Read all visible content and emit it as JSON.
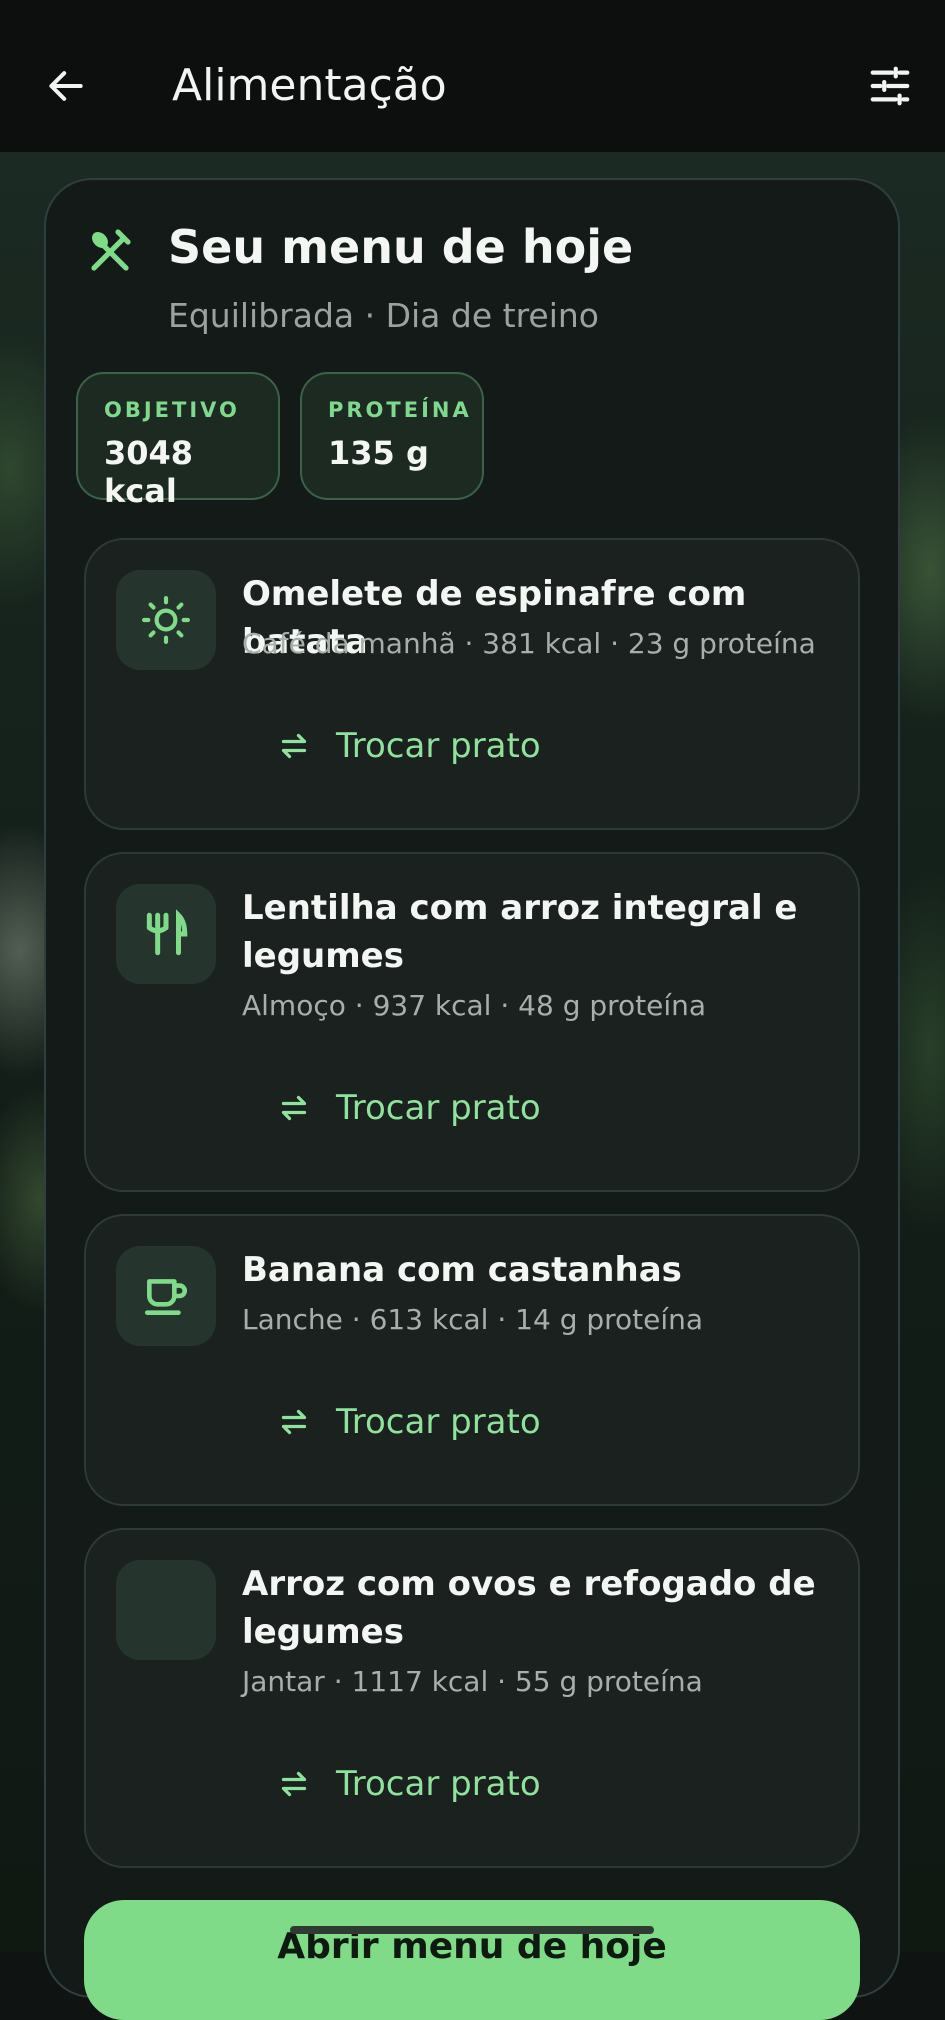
{
  "header": {
    "title": "Alimentação",
    "back_icon": "arrow-left-icon",
    "filter_icon": "sliders-icon"
  },
  "menu": {
    "title": "Seu menu de hoje",
    "subtitle": "Equilibrada · Dia de treino",
    "icon": "utensils-crossed-icon",
    "stats": [
      {
        "label": "OBJETIVO",
        "value": "3048 kcal"
      },
      {
        "label": "PROTEÍNA",
        "value": "135 g"
      }
    ],
    "meals": [
      {
        "name": "Omelete de espinafre com batata",
        "info": "Café da manhã · 381 kcal · 23 g proteína",
        "icon": "sun-icon",
        "swap_label": "Trocar prato"
      },
      {
        "name": "Lentilha com arroz integral e legumes",
        "info": "Almoço · 937 kcal · 48 g proteína",
        "icon": "fork-knife-icon",
        "swap_label": "Trocar prato"
      },
      {
        "name": "Banana com castanhas",
        "info": "Lanche · 613 kcal · 14 g proteína",
        "icon": "coffee-cup-icon",
        "swap_label": "Trocar prato"
      },
      {
        "name": "Arroz com ovos e refogado de legumes",
        "info": "Jantar · 1117 kcal · 55 g proteína",
        "icon": "moon-icon",
        "swap_label": "Trocar prato"
      }
    ],
    "cta_label": "Abrir menu de hoje"
  },
  "colors": {
    "accent": "#7fdb88",
    "panel": "#141a18",
    "card": "#1a211e"
  }
}
